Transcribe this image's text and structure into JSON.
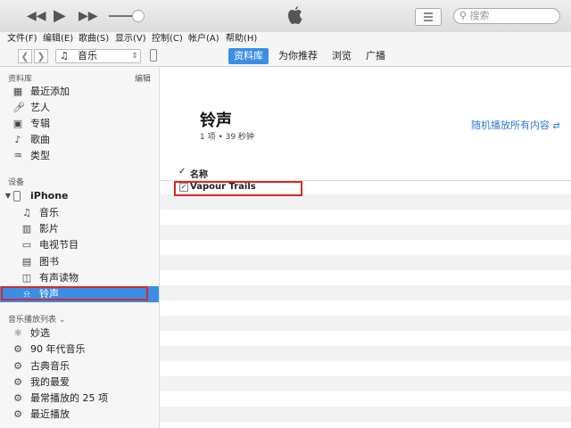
{
  "search": {
    "placeholder": "搜索"
  },
  "menu": [
    "文件(F)",
    "编辑(E)",
    "歌曲(S)",
    "显示(V)",
    "控制(C)",
    "帐户(A)",
    "帮助(H)"
  ],
  "nav": {
    "media_label": "音乐",
    "tabs": [
      "资料库",
      "为你推荐",
      "浏览",
      "广播"
    ],
    "active_tab": "资料库"
  },
  "sidebar": {
    "library_title": "资料库",
    "edit_label": "编辑",
    "library_items": [
      "最近添加",
      "艺人",
      "专辑",
      "歌曲",
      "类型"
    ],
    "devices_title": "设备",
    "device_name": "iPhone",
    "device_items": [
      "音乐",
      "影片",
      "电视节目",
      "图书",
      "有声读物",
      "铃声"
    ],
    "selected_item": "铃声",
    "playlists_title": "音乐播放列表",
    "playlist_items": [
      "妙选",
      "90 年代音乐",
      "古典音乐",
      "我的最爱",
      "最常播放的 25 项",
      "最近播放"
    ]
  },
  "main": {
    "title": "铃声",
    "subtitle": "1 项 • 39 秒钟",
    "shuffle_label": "随机播放所有内容",
    "column_name": "名称",
    "check_mark": "✓",
    "tracks": [
      {
        "name": "Vapour Trails",
        "checked": true
      }
    ]
  },
  "colors": {
    "accent": "#3a8ee6",
    "highlight_outline": "#d42a2a",
    "link": "#2f7bd6"
  }
}
